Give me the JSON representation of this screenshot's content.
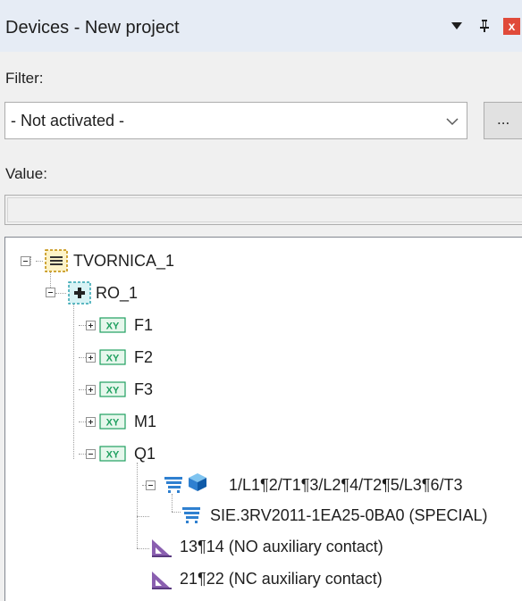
{
  "window": {
    "title": "Devices - New project",
    "close_glyph": "x"
  },
  "filter": {
    "label": "Filter:",
    "selected": "- Not activated -",
    "browse_label": "..."
  },
  "value": {
    "label": "Value:",
    "text": ""
  },
  "tree": {
    "nodes": [
      {
        "label": "TVORNICA_1",
        "icon": "plant-icon",
        "expanded": true
      },
      {
        "label": "RO_1",
        "icon": "location-icon",
        "expanded": true
      },
      {
        "label": "F1",
        "icon": "xy-device-icon",
        "expanded": false
      },
      {
        "label": "F2",
        "icon": "xy-device-icon",
        "expanded": false
      },
      {
        "label": "F3",
        "icon": "xy-device-icon",
        "expanded": false
      },
      {
        "label": "M1",
        "icon": "xy-device-icon",
        "expanded": false
      },
      {
        "label": "Q1",
        "icon": "xy-device-icon",
        "expanded": true
      },
      {
        "label": "1/L1¶2/T1¶3/L2¶4/T2¶5/L3¶6/T3",
        "icon": "part-cart-3d-icon",
        "expanded": true
      },
      {
        "label": "SIE.3RV2011-1EA25-0BA0 (SPECIAL)",
        "icon": "part-cart-icon"
      },
      {
        "label": "13¶14 (NO auxiliary contact)",
        "icon": "contact-triangle-icon"
      },
      {
        "label": "21¶22 (NC auxiliary contact)",
        "icon": "contact-triangle-icon"
      }
    ]
  },
  "colors": {
    "titlebar_bg": "#e6ecf5",
    "panel_bg": "#f0f0f0",
    "close_red": "#e04a3a",
    "xy_green": "#20a060",
    "cart_blue": "#2f80d0",
    "triangle_purple": "#8a5fb0"
  }
}
